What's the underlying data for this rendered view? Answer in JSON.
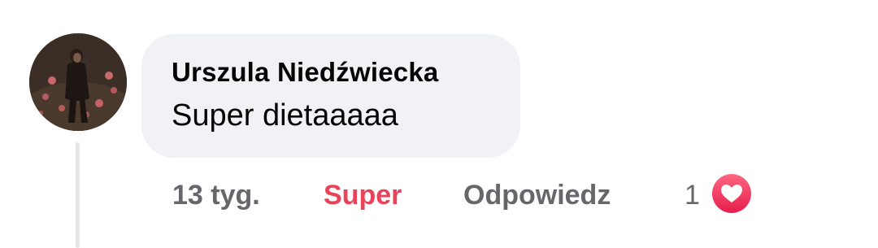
{
  "comment": {
    "author": "Urszula Niedźwiecka",
    "text": "Super dietaaaaa",
    "timestamp": "13 tyg.",
    "reaction_label": "Super",
    "reply_label": "Odpowiedz",
    "reaction_count": "1",
    "reaction_icon": "heart-icon",
    "avatar_icon": "profile-photo"
  },
  "colors": {
    "bubble_background": "#f0f2f5",
    "reaction_accent": "#e9435a",
    "secondary_text": "#65676b",
    "thread_line": "#e4e6ea"
  }
}
